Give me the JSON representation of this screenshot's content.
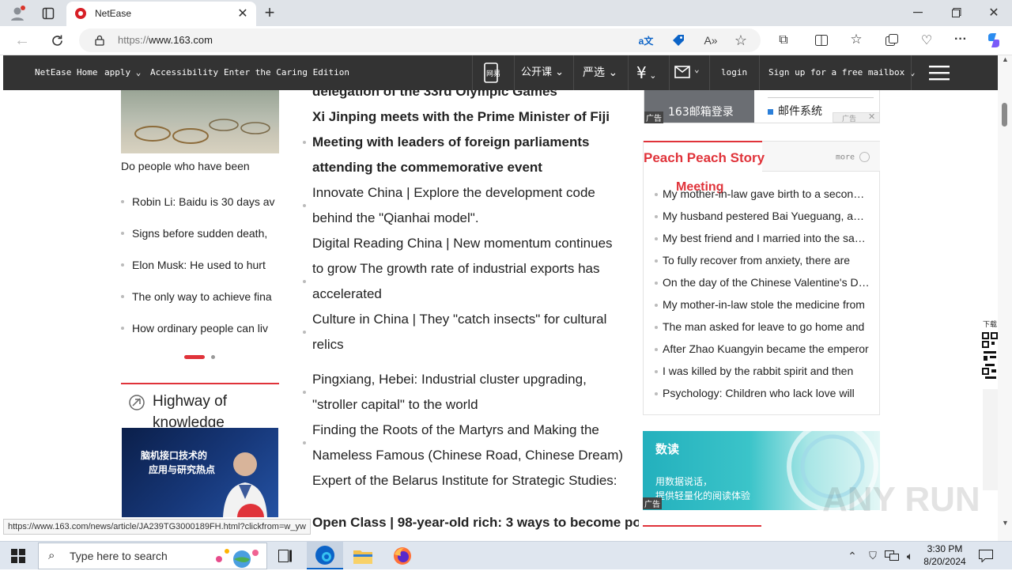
{
  "browser": {
    "tab_title": "NetEase",
    "url_scheme": "https://",
    "url_host": "www.163.com",
    "status_url": "https://www.163.com/news/article/JA239TG3000189FH.html?clickfrom=w_yw"
  },
  "sitenav": {
    "links": [
      "NetEase Home",
      "apply",
      "Accessibility",
      "Enter the Caring Edition"
    ],
    "app_label": "网易",
    "open_course": "公开课",
    "yanxuan": "严选",
    "login": "login",
    "signup": "Sign up for a free mailbox"
  },
  "left": {
    "photo_caption": "Do people who have been",
    "list": [
      "Robin Li: Baidu is 30 days av",
      "Signs before sudden death,",
      "Elon Musk: He used to hurt",
      "The only way to achieve fina",
      "How ordinary people can liv"
    ],
    "section_title_1": "Highway of",
    "section_title_2": "knowledge",
    "video_title_1": "脑机接口技术的",
    "video_title_2": "应用与研究热点"
  },
  "center": {
    "lines": [
      {
        "text": "delegation of the 33rd Olympic Games",
        "bold": true
      },
      {
        "text": "Xi Jinping meets with the Prime Minister of Fiji",
        "bold": true
      },
      {
        "text": "Meeting with leaders of foreign parliaments",
        "bold": true
      },
      {
        "text": "attending the commemorative event",
        "bold": true
      },
      {
        "text": "Innovate China | Explore the development code",
        "bold": false
      },
      {
        "text": "behind the \"Qianhai model\".",
        "bold": false
      },
      {
        "text": "Digital Reading China | New momentum continues",
        "bold": false
      },
      {
        "text": "to grow The growth rate of industrial exports has",
        "bold": false
      },
      {
        "text": "accelerated",
        "bold": false
      },
      {
        "text": "Culture in China | They \"catch insects\" for cultural",
        "bold": false
      },
      {
        "text": "relics",
        "bold": false
      },
      {
        "text": "Pingxiang, Hebei: Industrial cluster upgrading,",
        "bold": false
      },
      {
        "text": "\"stroller capital\" to the world",
        "bold": false
      },
      {
        "text": "Finding the Roots of the Martyrs and Making the",
        "bold": false
      },
      {
        "text": "Nameless Famous (Chinese Road, Chinese Dream)",
        "bold": false
      },
      {
        "text": "Expert of the Belarus Institute for Strategic Studies:",
        "bold": false
      },
      {
        "text": "Open Class | 98-year-old rich: 3 ways to become po",
        "bold": true
      }
    ]
  },
  "right": {
    "mail_login": "163邮箱登录",
    "mail_system": "邮件系统",
    "ad_label": "广告",
    "story_title": "Peach Peach Story",
    "story_more": "more",
    "story_overlay": "Meeting",
    "stories": [
      "My mother-in-law gave birth to a second child",
      "My husband pestered Bai Yueguang, and I",
      "My best friend and I married into the same",
      "To fully recover from anxiety, there are",
      "On the day of the Chinese Valentine's Day",
      "My mother-in-law stole the medicine from",
      "The man asked for leave to go home and",
      "After Zhao Kuangyin became the emperor",
      "I was killed by the rabbit spirit and then",
      "Psychology: Children who lack love will"
    ],
    "banner_brand": "数读",
    "banner_line1": "用数据说话，",
    "banner_line2": "提供轻量化的阅读体验",
    "qr_label": "下载"
  },
  "watermark": "ANY RUN",
  "taskbar": {
    "search_placeholder": "Type here to search",
    "time": "3:30 PM",
    "date": "8/20/2024"
  },
  "colors": {
    "accent_red": "#e0333a",
    "nav_bg": "#333333",
    "edge_blue": "#0b63c7"
  }
}
